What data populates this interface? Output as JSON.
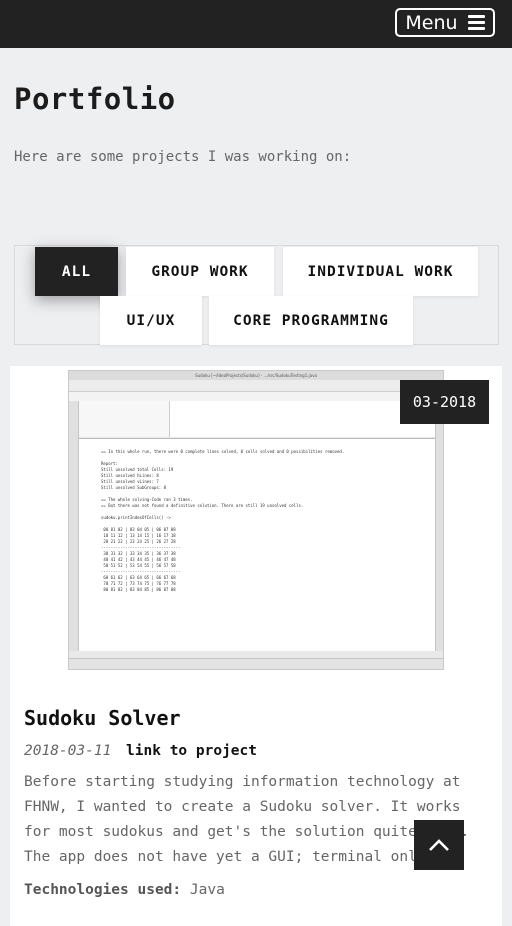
{
  "header": {
    "menu_label": "Menu"
  },
  "portfolio": {
    "title": "Portfolio",
    "intro": "Here are some projects I was working on:"
  },
  "filters": [
    "ALL",
    "GROUP WORK",
    "INDIVIDUAL WORK",
    "UI/UX",
    "CORE PROGRAMMING"
  ],
  "active_filter": "ALL",
  "project": {
    "date_badge": "03-2018",
    "title": "Sudoku Solver",
    "date": "2018-03-11",
    "link_label": "link to project",
    "description": "Before starting studying information technology at FHNW, I wanted to create a Sudoku solver. It works for most sudokus and get's the solution quite fast. The app does not have yet a GUI; terminal only.",
    "tech_label": "Technologies used:",
    "tech_value": "Java",
    "screenshot": {
      "window_title": "Sudoku [~/IdeaProjects/Sudoku] - .../src/SudokuTesting1.java",
      "console": "== In this whole run, there were 0 complete lines solved, 0 cells solved and 0 possibilities removed.\n\nReport:\nStill unsolved total Cells: 19\nStill unsolved hLines: 8\nStill unsolved vLines: 7\nStill unsolved SubGroups: 8\n\n== The whole solving-Code ran 3 times.\n== But there was not found a definitive solution. There are still 19 unsolved cells.\n\nsudoku.printIndexOfCells() ->\n\n 00 01 02 | 03 04 05 | 06 07 08\n 10 11 12 | 13 14 15 | 16 17 18\n 20 21 22 | 23 24 25 | 26 27 28\n---------------------------------\n 30 31 32 | 33 34 35 | 36 37 38\n 40 41 42 | 43 44 45 | 46 47 48\n 50 51 52 | 53 54 55 | 56 57 58\n---------------------------------\n 60 61 62 | 63 64 65 | 66 67 68\n 70 71 72 | 73 74 75 | 76 77 78\n 80 81 82 | 83 84 85 | 86 87 88"
    }
  },
  "colors": {
    "dark": "#222222",
    "background": "#eeeff1",
    "muted_text": "#666666"
  }
}
